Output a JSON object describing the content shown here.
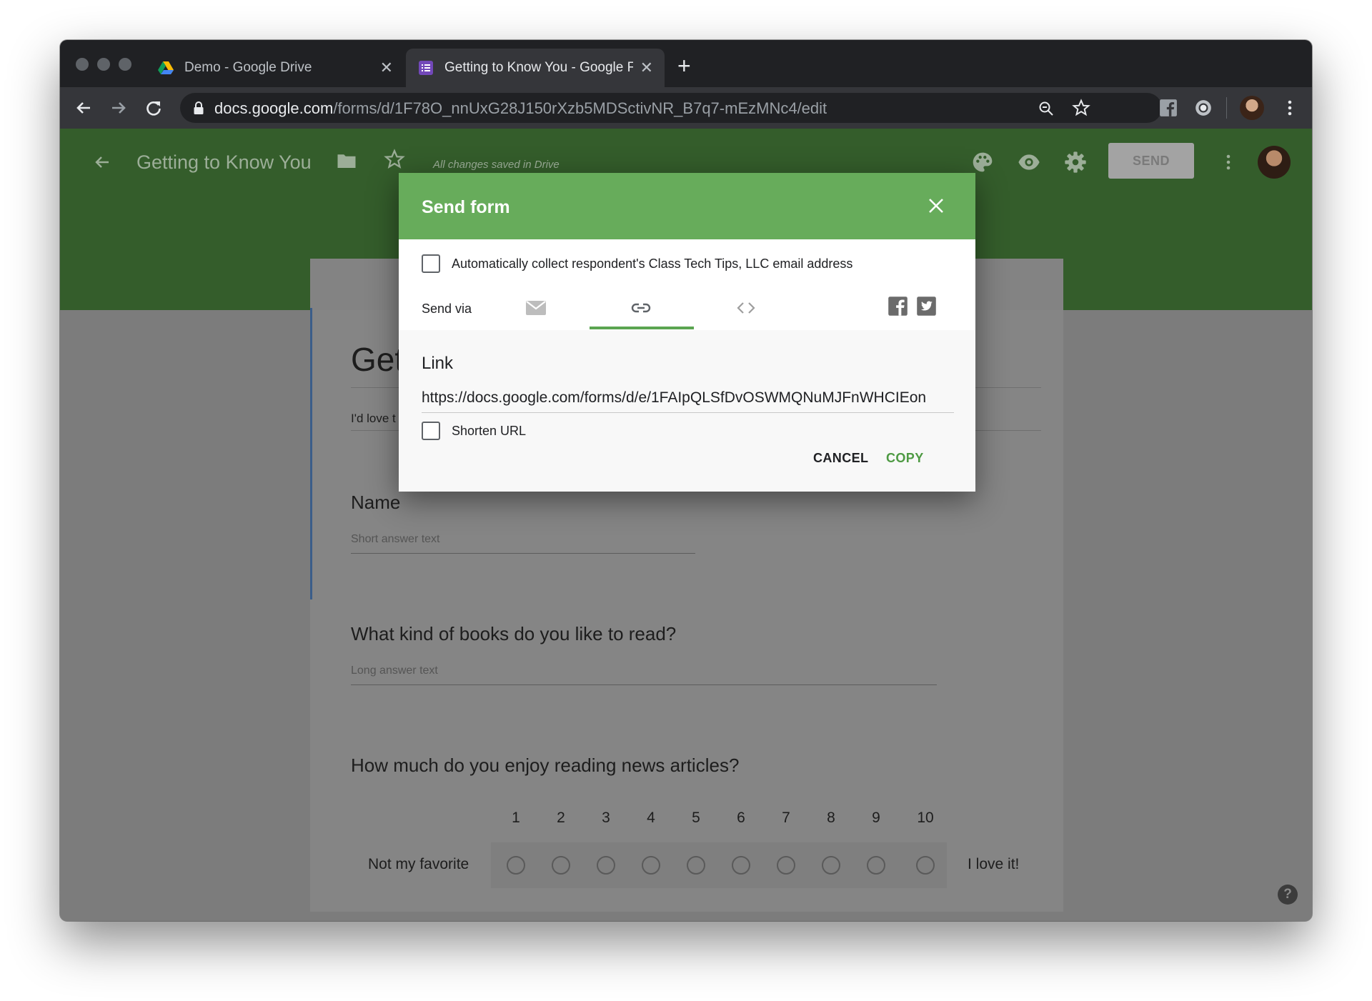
{
  "browser": {
    "tabs": [
      {
        "title": "Demo - Google Drive",
        "favicon": "google-drive-icon",
        "active": false
      },
      {
        "title": "Getting to Know You - Google Forms",
        "favicon": "google-forms-icon",
        "active": true
      }
    ],
    "url_host": "docs.google.com",
    "url_path": "/forms/d/1F78O_nnUxG28J150rXzb5MDSctivNR_B7q7-mEzMNc4/edit"
  },
  "forms_header": {
    "title": "Getting to Know You",
    "save_status": "All changes saved in Drive",
    "send_label": "SEND"
  },
  "form": {
    "title_fragment": "Get",
    "description_fragment": "I'd love t",
    "questions": [
      {
        "title": "Name",
        "hint": "Short answer text"
      },
      {
        "title": "What kind of books do you like to read?",
        "hint": "Long answer text"
      },
      {
        "title": "How much do you enjoy reading news articles?",
        "scale": [
          "1",
          "2",
          "3",
          "4",
          "5",
          "6",
          "7",
          "8",
          "9",
          "10"
        ],
        "low_label": "Not my favorite",
        "high_label": "I love it!"
      }
    ]
  },
  "dialog": {
    "title": "Send form",
    "collect_email_label": "Automatically collect respondent's Class Tech Tips, LLC email address",
    "send_via_label": "Send via",
    "link_heading": "Link",
    "link_url": "https://docs.google.com/forms/d/e/1FAIpQLSfDvOSWMQNuMJFnWHCIEon",
    "shorten_label": "Shorten URL",
    "cancel_label": "CANCEL",
    "copy_label": "COPY"
  },
  "colors": {
    "dialog_header": "#67ac5b",
    "accent_green": "#5ba551",
    "copy_text": "#4e9a43"
  }
}
